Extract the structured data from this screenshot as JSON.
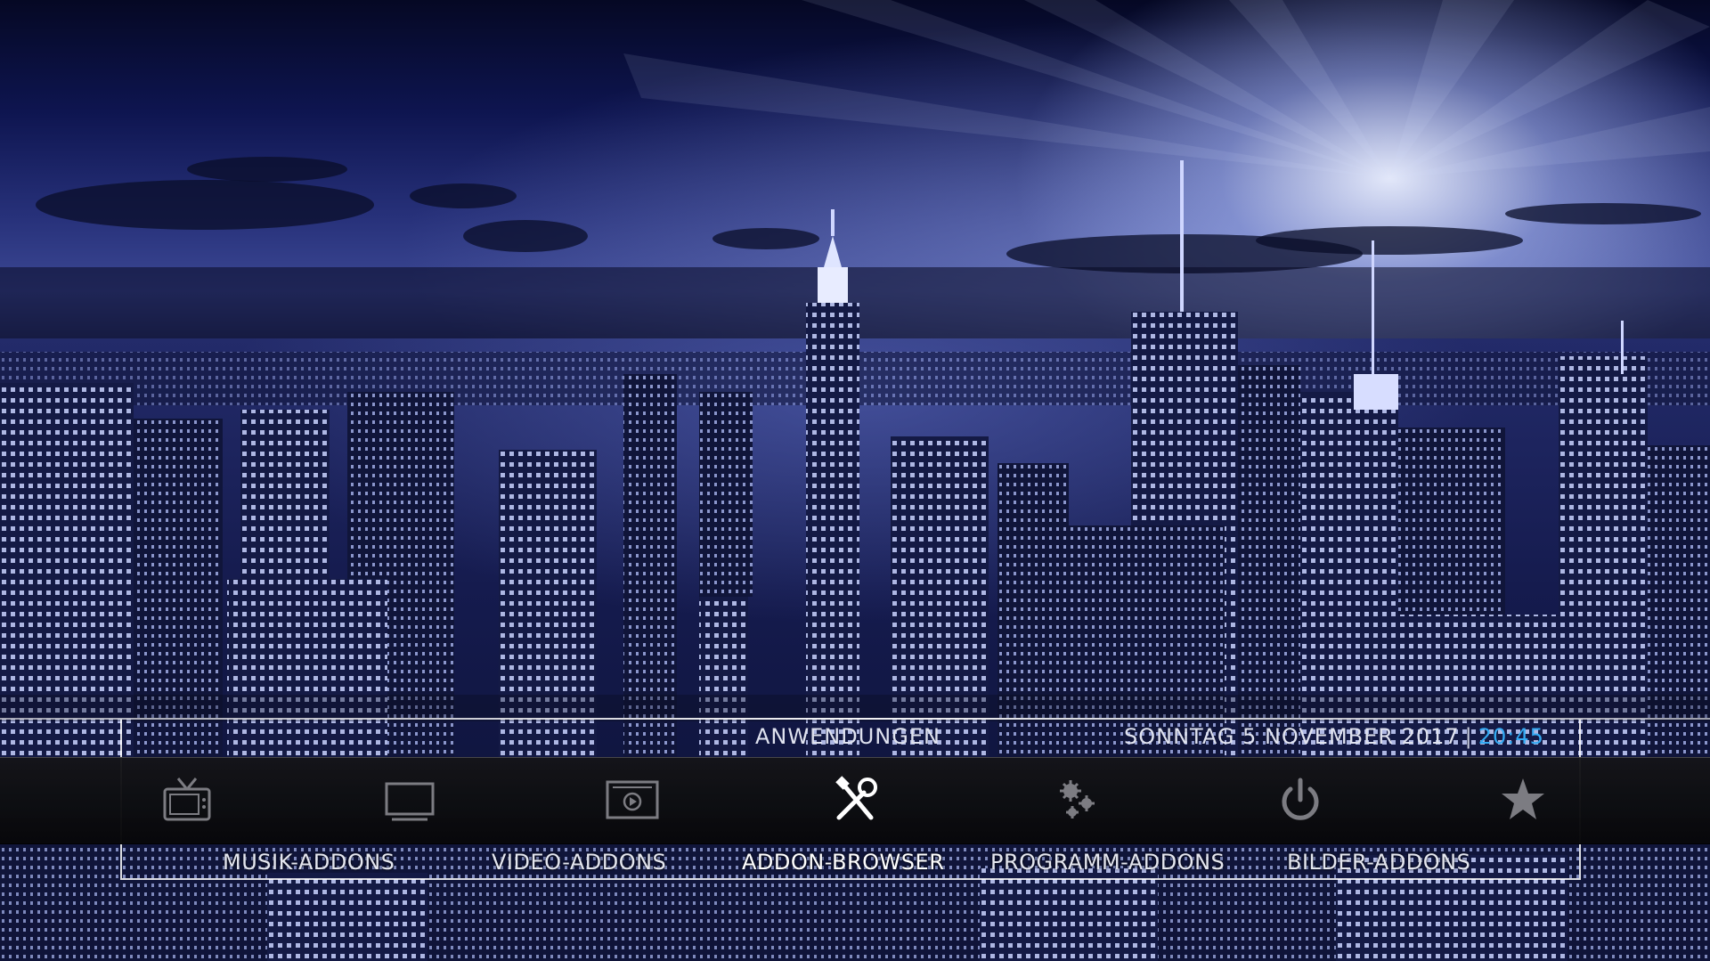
{
  "section_title": "ANWENDUNGEN",
  "date": "SONNTAG 5 NOVEMBER 2017",
  "separator": "|",
  "time": "20:45",
  "menu": [
    {
      "icon": "tv-icon",
      "label": ""
    },
    {
      "icon": "screen-icon",
      "label": "MUSIK-ADDONS"
    },
    {
      "icon": "video-icon",
      "label": "VIDEO-ADDONS"
    },
    {
      "icon": "tools-icon",
      "label": "ADDON-BROWSER",
      "selected": true
    },
    {
      "icon": "gears-icon",
      "label": "PROGRAMM-ADDONS"
    },
    {
      "icon": "power-icon",
      "label": "BILDER-ADDONS"
    },
    {
      "icon": "star-icon",
      "label": ""
    }
  ],
  "colors": {
    "accent_time": "#33a9f2",
    "bar": "#0e0e12",
    "sky_tint": "#27317a"
  }
}
